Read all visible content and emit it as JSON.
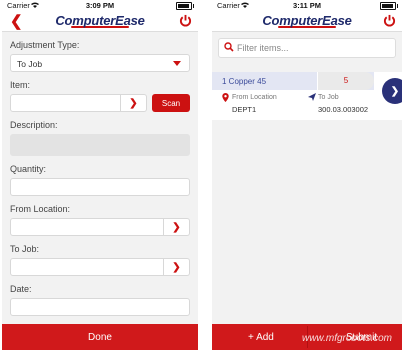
{
  "left": {
    "status": {
      "carrier": "Carrier",
      "time": "3:09 PM"
    },
    "app_title": "ComputerEase",
    "fields": {
      "adjustment_type_label": "Adjustment Type:",
      "adjustment_type_value": "To Job",
      "item_label": "Item:",
      "scan_button": "Scan",
      "description_label": "Description:",
      "quantity_label": "Quantity:",
      "from_location_label": "From Location:",
      "to_job_label": "To Job:",
      "date_label": "Date:"
    },
    "done_button": "Done"
  },
  "right": {
    "status": {
      "carrier": "Carrier",
      "time": "3:11 PM"
    },
    "app_title": "ComputerEase",
    "filter_placeholder": "Filter items...",
    "item": {
      "name": "1 Copper 45",
      "quantity": "5",
      "from_location_label": "From Location",
      "from_location_value": "DEPT1",
      "to_job_label": "To Job",
      "to_job_value": "300.03.003002"
    },
    "add_button": "+ Add",
    "submit_button": "Submit"
  },
  "watermark": "www.mfgrobots.com",
  "colors": {
    "accent_red": "#d0191b",
    "brand_navy": "#1f2a6b"
  }
}
